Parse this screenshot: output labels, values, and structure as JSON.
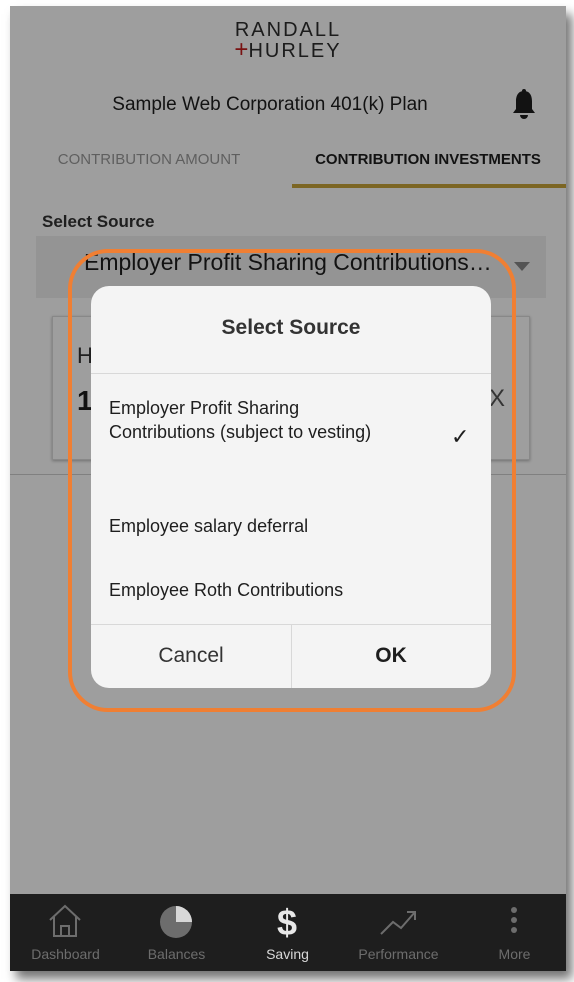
{
  "header": {
    "logo_line1": "RANDALL",
    "logo_line2_plus": "+",
    "logo_line2": "HURLEY",
    "plan_title": "Sample Web Corporation 401(k) Plan"
  },
  "tabs": [
    {
      "label": "CONTRIBUTION AMOUNT",
      "active": false
    },
    {
      "label": "CONTRIBUTION INVESTMENTS",
      "active": true
    }
  ],
  "source_select": {
    "label": "Select Source",
    "value": "Employer Profit Sharing Contributions (subject to vesting)"
  },
  "card": {
    "heading_partial": "H",
    "value_partial": "1",
    "close_label": "X"
  },
  "dialog": {
    "title": "Select Source",
    "options": [
      {
        "label": "Employer Profit Sharing Contributions (subject to vesting)",
        "selected": true
      },
      {
        "label": "Employee salary deferral",
        "selected": false
      },
      {
        "label": "Employee Roth Contributions",
        "selected": false
      }
    ],
    "check_glyph": "✓",
    "cancel_label": "Cancel",
    "ok_label": "OK"
  },
  "nav": [
    {
      "label": "Dashboard",
      "icon": "home-icon",
      "active": false
    },
    {
      "label": "Balances",
      "icon": "pie-chart-icon",
      "active": false
    },
    {
      "label": "Saving",
      "icon": "dollar-icon",
      "active": true
    },
    {
      "label": "Performance",
      "icon": "trend-icon",
      "active": false
    },
    {
      "label": "More",
      "icon": "more-vertical-icon",
      "active": false
    }
  ],
  "colors": {
    "accent_tab": "#c8a53a",
    "logo_plus": "#c41e1e",
    "highlight_ring": "#f07f33",
    "nav_background": "#1e1e1e"
  }
}
